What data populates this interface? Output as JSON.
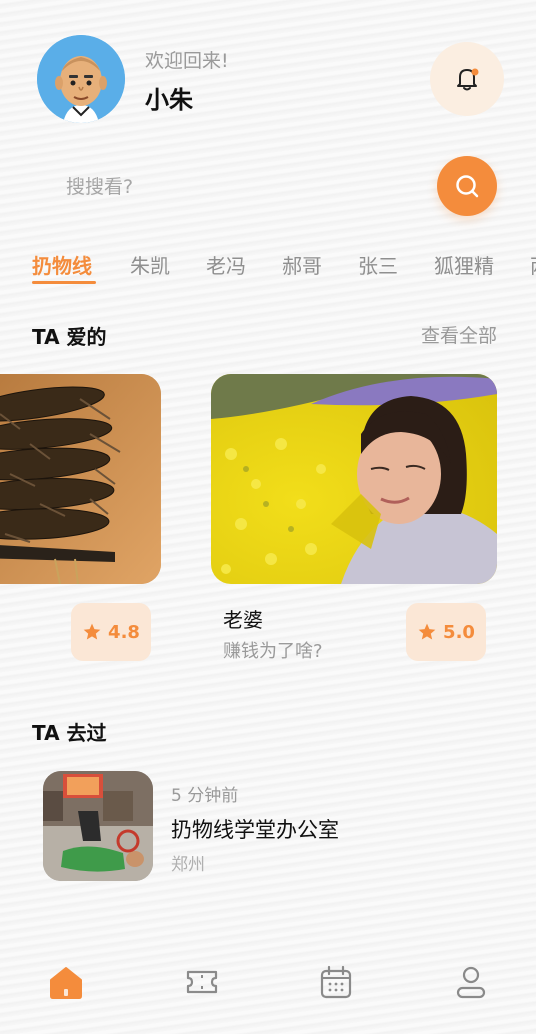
{
  "header": {
    "welcome_text": "欢迎回来!",
    "username": "小朱"
  },
  "search": {
    "placeholder": "搜搜看?"
  },
  "tabs": [
    {
      "label": "扔物线",
      "active": true
    },
    {
      "label": "朱凯",
      "active": false
    },
    {
      "label": "老冯",
      "active": false
    },
    {
      "label": "郝哥",
      "active": false
    },
    {
      "label": "张三",
      "active": false
    },
    {
      "label": "狐狸精",
      "active": false
    },
    {
      "label": "两",
      "active": false
    }
  ],
  "favorites": {
    "title": "TA 爱的",
    "view_all": "查看全部",
    "cards": [
      {
        "rating": "4.8"
      },
      {
        "name": "老婆",
        "subtitle": "赚钱为了啥?",
        "rating": "5.0"
      }
    ]
  },
  "visited": {
    "title": "TA 去过",
    "items": [
      {
        "time": "5 分钟前",
        "place": "扔物线学堂办公室",
        "city": "郑州"
      }
    ]
  },
  "bottom_nav": {
    "items": [
      {
        "icon": "home-icon",
        "active": true
      },
      {
        "icon": "ticket-icon",
        "active": false
      },
      {
        "icon": "calendar-icon",
        "active": false
      },
      {
        "icon": "profile-icon",
        "active": false
      }
    ]
  },
  "colors": {
    "accent": "#f48c3c",
    "accent_light": "#fbe7d6",
    "text_primary": "#111111",
    "text_secondary": "#9a9a9a"
  }
}
